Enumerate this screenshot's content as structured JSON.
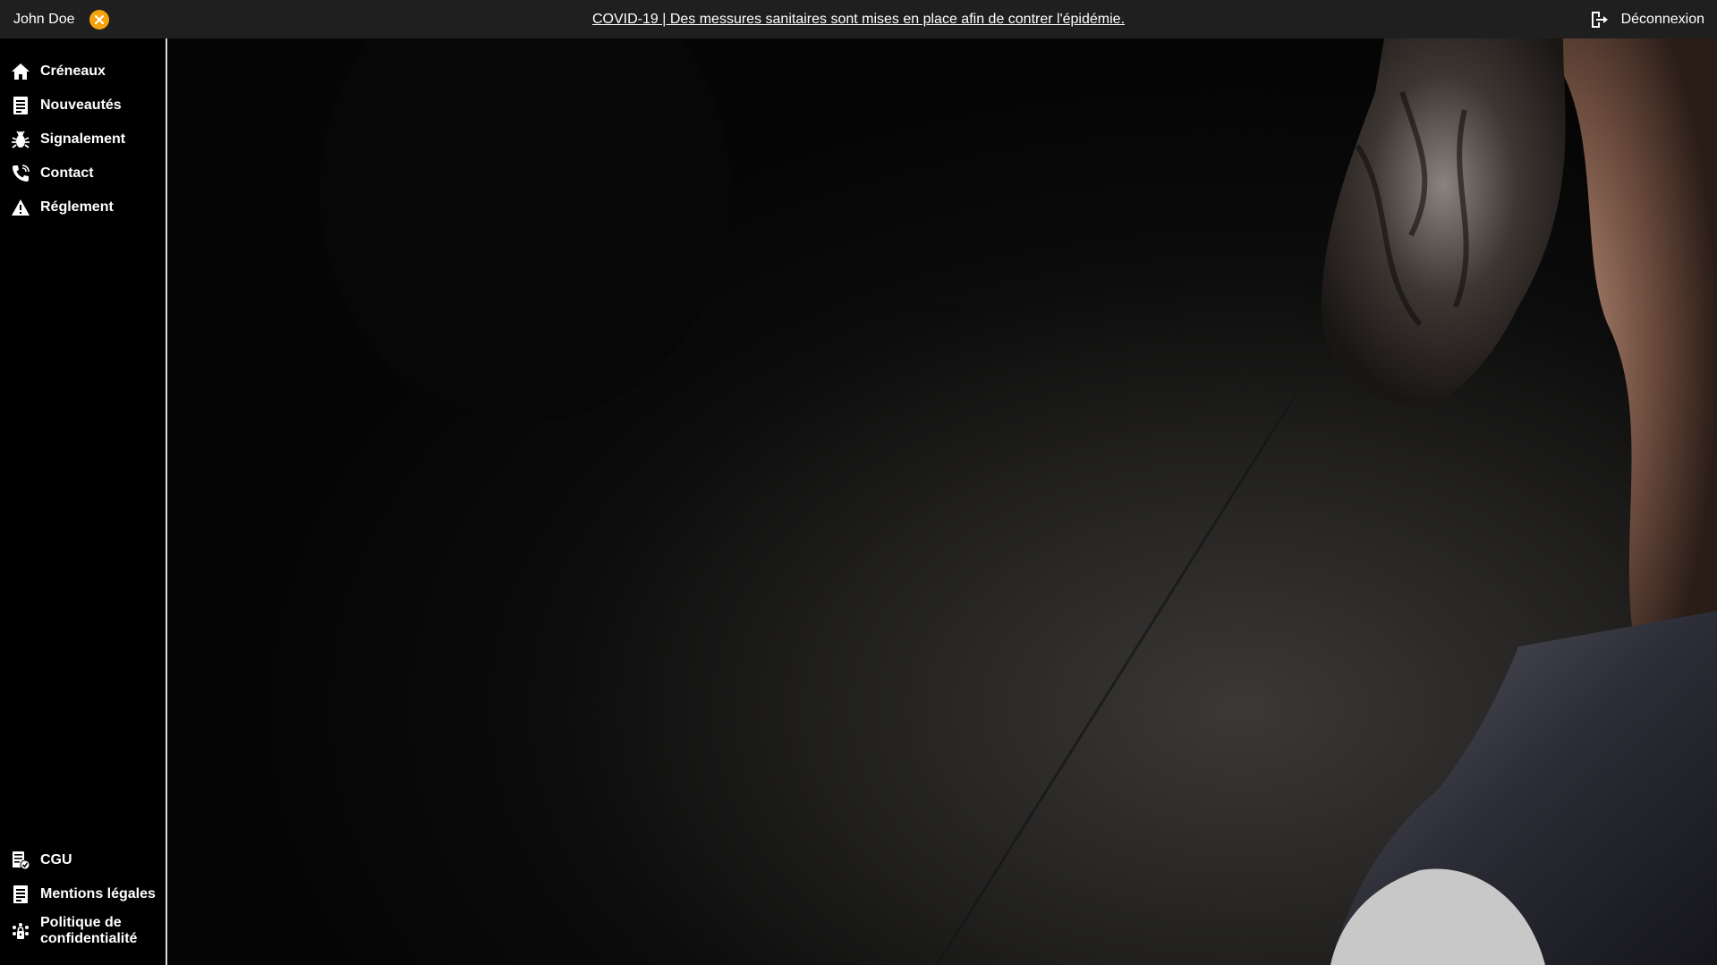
{
  "topbar": {
    "user_name": "John Doe",
    "announcement": "COVID-19 | Des messures sanitaires sont mises en place afin de contrer l'épidémie.",
    "logout_label": "Déconnexion"
  },
  "sidebar": {
    "items": [
      {
        "label": "Créneaux",
        "icon": "home-icon"
      },
      {
        "label": "Nouveautés",
        "icon": "news-icon"
      },
      {
        "label": "Signalement",
        "icon": "bug-icon"
      },
      {
        "label": "Contact",
        "icon": "phone-icon"
      },
      {
        "label": "Réglement",
        "icon": "warning-icon"
      }
    ],
    "bottom_items": [
      {
        "label": "CGU",
        "icon": "document-check-icon"
      },
      {
        "label": "Mentions légales",
        "icon": "document-icon"
      },
      {
        "label_line1": "Politique de",
        "label_line2": "confidentialité",
        "icon": "privacy-icon"
      }
    ]
  },
  "colors": {
    "topbar_bg": "#1f1f1f",
    "sidebar_bg": "#000000",
    "accent": "#f5a20f"
  }
}
